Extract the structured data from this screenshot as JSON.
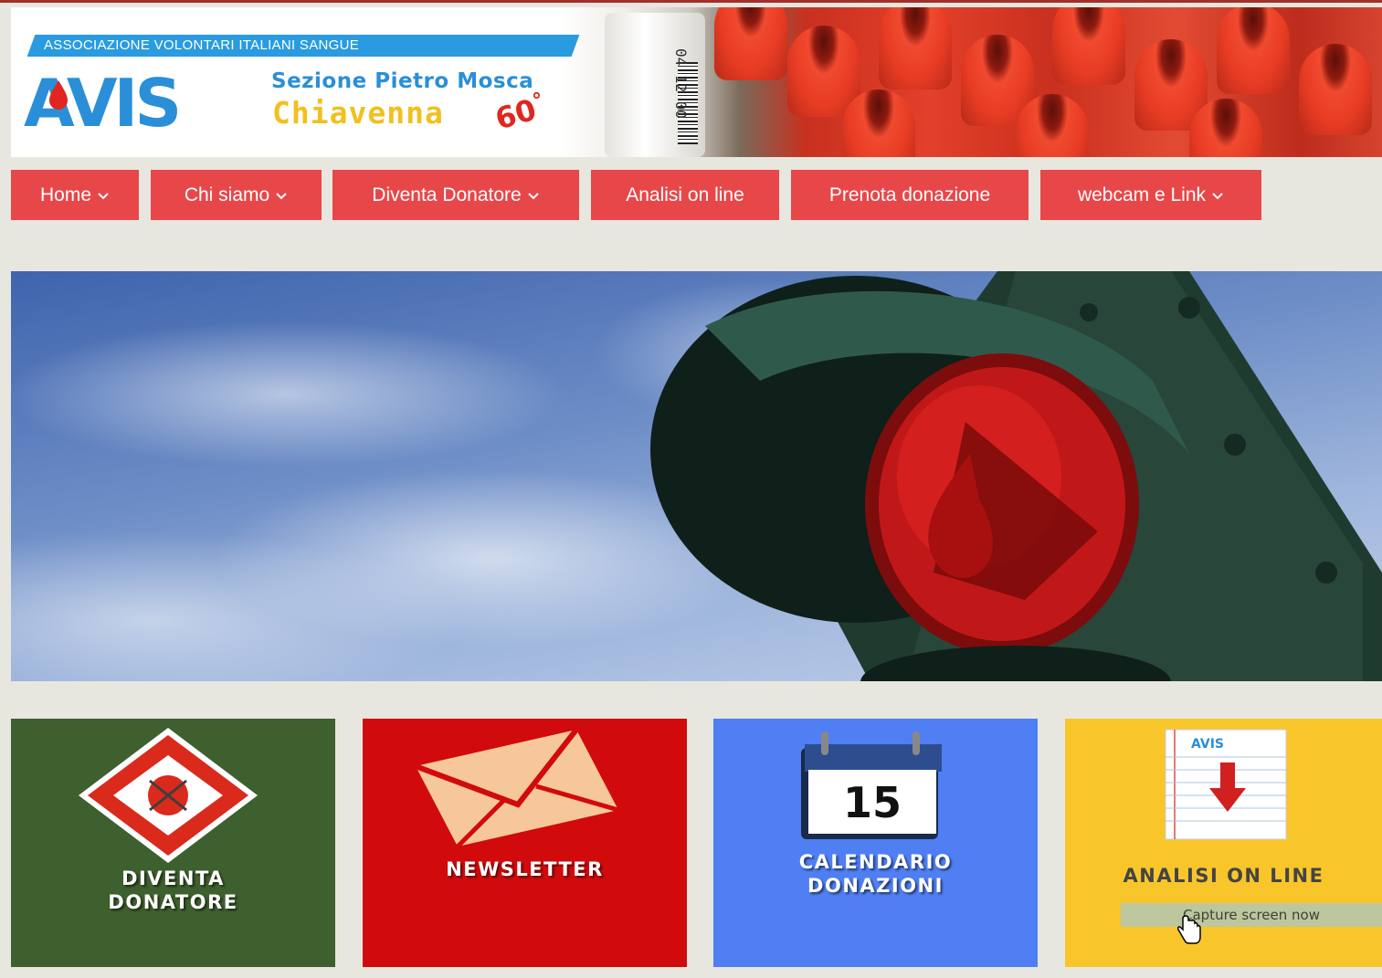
{
  "header": {
    "association": "ASSOCIAZIONE VOLONTARI ITALIANI SANGUE",
    "logo_text": "AVIS",
    "section": "Sezione  Pietro  Mosca",
    "city": "Chiavenna",
    "anniversary": "60",
    "anniversary_sup": "°",
    "vial_label": "04 12 00"
  },
  "nav": {
    "items": [
      {
        "label": "Home",
        "has_dropdown": true
      },
      {
        "label": "Chi siamo",
        "has_dropdown": true
      },
      {
        "label": "Diventa Donatore",
        "has_dropdown": true
      },
      {
        "label": "Analisi on line",
        "has_dropdown": false
      },
      {
        "label": "Prenota donazione",
        "has_dropdown": false
      },
      {
        "label": "webcam e Link",
        "has_dropdown": true
      }
    ]
  },
  "tiles": [
    {
      "line1": "DIVENTA",
      "line2": "DONATORE",
      "color": "#3e5f2e"
    },
    {
      "line1": "NEWSLETTER",
      "line2": "",
      "color": "#d10a0c"
    },
    {
      "line1": "CALENDARIO",
      "line2": "DONAZIONI",
      "color": "#4f7ff2",
      "calendar_day": "15"
    },
    {
      "line1": "ANALISI ON LINE",
      "line2": "",
      "color": "#f8c62b",
      "report_logo": "AVIS"
    }
  ],
  "overlay": {
    "capture_label": "Capture screen now"
  },
  "colors": {
    "nav_bg": "#e8474a",
    "page_bg": "#e8e7df",
    "brand_blue": "#2a9be0",
    "brand_yellow": "#f2c01e"
  }
}
